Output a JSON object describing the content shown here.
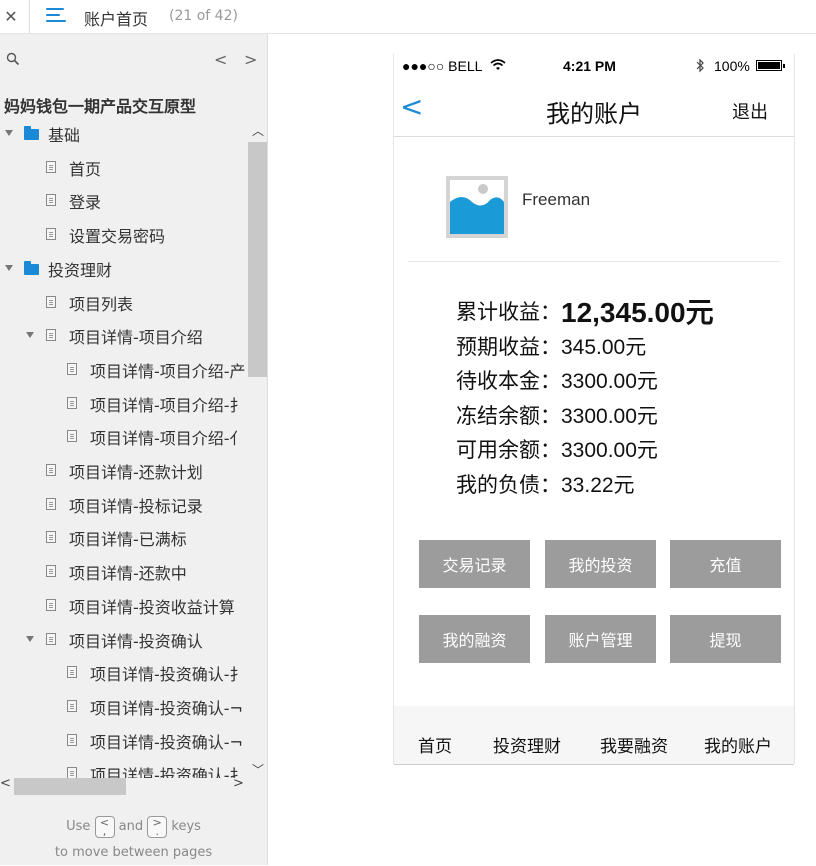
{
  "topbar": {
    "close_icon": "close-icon",
    "menu_icon": "hamburger-icon",
    "title": "账户首页",
    "count": "(21 of 42)"
  },
  "sidebar": {
    "project_title": "妈妈钱包一期产品交互原型",
    "tree": [
      {
        "label": "基础",
        "type": "folder",
        "level": 0,
        "expanded": true
      },
      {
        "label": "首页",
        "type": "page",
        "level": 1
      },
      {
        "label": "登录",
        "type": "page",
        "level": 1
      },
      {
        "label": "设置交易密码",
        "type": "page",
        "level": 1
      },
      {
        "label": "投资理财",
        "type": "folder",
        "level": 0,
        "expanded": true
      },
      {
        "label": "项目列表",
        "type": "page",
        "level": 1
      },
      {
        "label": "项目详情-项目介绍",
        "type": "page",
        "level": 1,
        "expanded": true
      },
      {
        "label": "项目详情-项目介绍-产",
        "type": "page",
        "level": 2
      },
      {
        "label": "项目详情-项目介绍-扌",
        "type": "page",
        "level": 2
      },
      {
        "label": "项目详情-项目介绍-亻",
        "type": "page",
        "level": 2
      },
      {
        "label": "项目详情-还款计划",
        "type": "page",
        "level": 1
      },
      {
        "label": "项目详情-投标记录",
        "type": "page",
        "level": 1
      },
      {
        "label": "项目详情-已满标",
        "type": "page",
        "level": 1
      },
      {
        "label": "项目详情-还款中",
        "type": "page",
        "level": 1
      },
      {
        "label": "项目详情-投资收益计算",
        "type": "page",
        "level": 1
      },
      {
        "label": "项目详情-投资确认",
        "type": "page",
        "level": 1,
        "expanded": true
      },
      {
        "label": "项目详情-投资确认-扌",
        "type": "page",
        "level": 2
      },
      {
        "label": "项目详情-投资确认-¬",
        "type": "page",
        "level": 2
      },
      {
        "label": "项目详情-投资确认-¬",
        "type": "page",
        "level": 2
      },
      {
        "label": "项目详情-投资确认-扌",
        "type": "page",
        "level": 2
      }
    ],
    "hint": {
      "use": "Use",
      "key1": ",",
      "and": "and",
      "key2": ".",
      "keys": "keys",
      "line2": "to move between pages"
    }
  },
  "phone": {
    "status": {
      "carrier": "●●●○○ BELL",
      "wifi_icon": "wifi-icon",
      "time": "4:21 PM",
      "bluetooth_icon": "bluetooth-icon",
      "battery": "100%"
    },
    "nav": {
      "back_icon": "chevron-left-icon",
      "title": "我的账户",
      "logout": "退出"
    },
    "user": {
      "name": "Freeman",
      "avatar_icon": "image-placeholder-icon"
    },
    "stats": [
      {
        "label": "累计收益：",
        "value": "12,345.00元"
      },
      {
        "label": "预期收益：",
        "value": "345.00元"
      },
      {
        "label": "待收本金：",
        "value": "3300.00元"
      },
      {
        "label": "冻结余额：",
        "value": "3300.00元"
      },
      {
        "label": "可用余额：",
        "value": "3300.00元"
      },
      {
        "label": "我的负债：",
        "value": "33.22元"
      }
    ],
    "buttons": [
      "交易记录",
      "我的投资",
      "充值",
      "我的融资",
      "账户管理",
      "提现"
    ],
    "tabs": [
      "首页",
      "投资理财",
      "我要融资",
      "我的账户"
    ],
    "colors": {
      "accent": "#1a8ad6",
      "button": "#9c9c9c"
    }
  }
}
